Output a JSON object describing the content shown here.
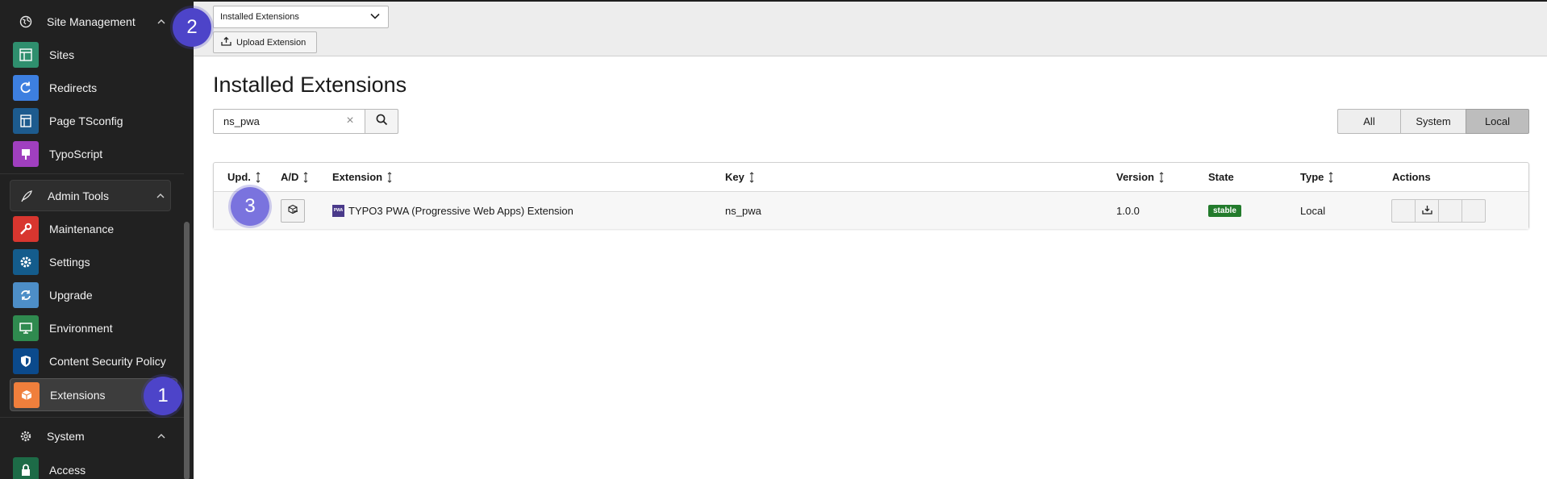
{
  "sidebar": {
    "groups": {
      "site_management": "Site Management",
      "admin_tools": "Admin Tools",
      "system": "System"
    },
    "items": [
      {
        "label": "Sites",
        "icon": "sites-icon",
        "color": "#2f8f6e"
      },
      {
        "label": "Redirects",
        "icon": "redirects-icon",
        "color": "#3d7fe0"
      },
      {
        "label": "Page TSconfig",
        "icon": "page-tsconfig-icon",
        "color": "#1d5b8e"
      },
      {
        "label": "TypoScript",
        "icon": "typoscript-icon",
        "color": "#a03fbf"
      },
      {
        "label": "Maintenance",
        "icon": "maintenance-icon",
        "color": "#d8362f"
      },
      {
        "label": "Settings",
        "icon": "settings-icon",
        "color": "#145c8c"
      },
      {
        "label": "Upgrade",
        "icon": "upgrade-icon",
        "color": "#4d8ec7"
      },
      {
        "label": "Environment",
        "icon": "environment-icon",
        "color": "#2f8a4f"
      },
      {
        "label": "Content Security Policy",
        "icon": "shield-icon",
        "color": "#0b4a8c"
      },
      {
        "label": "Extensions",
        "icon": "extensions-icon",
        "color": "#f07f3c"
      },
      {
        "label": "Access",
        "icon": "lock-icon",
        "color": "#1d6b47"
      }
    ]
  },
  "topbar": {
    "view_select": "Installed Extensions",
    "upload_label": "Upload Extension"
  },
  "main": {
    "title": "Installed Extensions",
    "search_value": "ns_pwa",
    "filters": [
      "All",
      "System",
      "Local"
    ],
    "active_filter": "Local"
  },
  "table": {
    "headers": {
      "upd": "Upd.",
      "ad": "A/D",
      "extension": "Extension",
      "key": "Key",
      "version": "Version",
      "state": "State",
      "type": "Type",
      "actions": "Actions"
    },
    "rows": [
      {
        "icon_text": "PWA",
        "extension": "TYPO3 PWA (Progressive Web Apps) Extension",
        "key": "ns_pwa",
        "version": "1.0.0",
        "state": "stable",
        "type": "Local"
      }
    ]
  },
  "steps": [
    "1",
    "2",
    "3"
  ]
}
